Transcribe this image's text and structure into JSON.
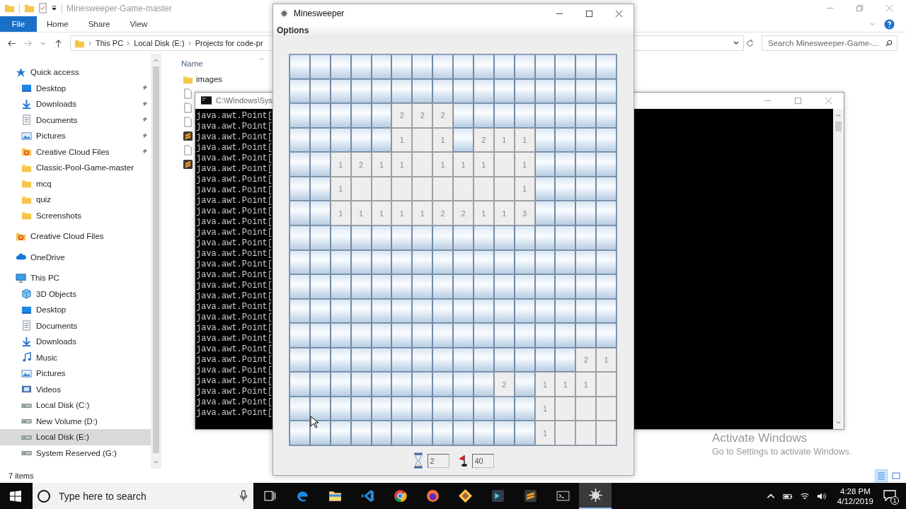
{
  "explorer": {
    "title": "Minesweeper-Game-master",
    "ribbon_tabs": [
      {
        "label": "File",
        "selected": true
      },
      {
        "label": "Home",
        "selected": false
      },
      {
        "label": "Share",
        "selected": false
      },
      {
        "label": "View",
        "selected": false
      }
    ],
    "breadcrumbs": [
      "This PC",
      "Local Disk (E:)",
      "Projects for code-pr"
    ],
    "search": {
      "placeholder": "Search Minesweeper-Game-..."
    },
    "navigation": [
      {
        "label": "Quick access",
        "kind": "star",
        "selected": false,
        "children": [
          {
            "label": "Desktop",
            "kind": "desktop",
            "pinned": true,
            "selected": false
          },
          {
            "label": "Downloads",
            "kind": "download",
            "pinned": true,
            "selected": false
          },
          {
            "label": "Documents",
            "kind": "documents",
            "pinned": true,
            "selected": false
          },
          {
            "label": "Pictures",
            "kind": "pictures",
            "pinned": true,
            "selected": false
          },
          {
            "label": "Creative Cloud Files",
            "kind": "cloudfiles",
            "pinned": true,
            "selected": false
          },
          {
            "label": "Classic-Pool-Game-master",
            "kind": "folder",
            "pinned": false,
            "selected": false
          },
          {
            "label": "mcq",
            "kind": "folder",
            "pinned": false,
            "selected": false
          },
          {
            "label": "quiz",
            "kind": "folder",
            "pinned": false,
            "selected": false
          },
          {
            "label": "Screenshots",
            "kind": "folder",
            "pinned": false,
            "selected": false
          }
        ]
      },
      {
        "label": "Creative Cloud Files",
        "kind": "cloudfiles",
        "selected": false
      },
      {
        "label": "OneDrive",
        "kind": "onedrive",
        "selected": false
      },
      {
        "label": "This PC",
        "kind": "pc",
        "selected": false,
        "children": [
          {
            "label": "3D Objects",
            "kind": "objects",
            "pinned": false,
            "selected": false
          },
          {
            "label": "Desktop",
            "kind": "desktop",
            "pinned": false,
            "selected": false
          },
          {
            "label": "Documents",
            "kind": "documents",
            "pinned": false,
            "selected": false
          },
          {
            "label": "Downloads",
            "kind": "download",
            "pinned": false,
            "selected": false
          },
          {
            "label": "Music",
            "kind": "music",
            "pinned": false,
            "selected": false
          },
          {
            "label": "Pictures",
            "kind": "pictures",
            "pinned": false,
            "selected": false
          },
          {
            "label": "Videos",
            "kind": "videos",
            "pinned": false,
            "selected": false
          },
          {
            "label": "Local Disk (C:)",
            "kind": "drive",
            "pinned": false,
            "selected": false
          },
          {
            "label": "New Volume (D:)",
            "kind": "drive",
            "pinned": false,
            "selected": false
          },
          {
            "label": "Local Disk (E:)",
            "kind": "drive",
            "pinned": false,
            "selected": true
          },
          {
            "label": "System Reserved (G:)",
            "kind": "drive",
            "pinned": false,
            "selected": false
          }
        ]
      }
    ],
    "column_header": "Name",
    "files": [
      {
        "name": "images",
        "kind": "folder"
      },
      {
        "kind": "file"
      },
      {
        "kind": "file"
      },
      {
        "kind": "file"
      },
      {
        "kind": "sublime"
      },
      {
        "kind": "file"
      },
      {
        "kind": "sublime"
      }
    ],
    "status": "7 items"
  },
  "console": {
    "title": "C:\\Windows\\Sys",
    "lines": [
      "java.awt.Point[",
      "java.awt.Point[",
      "java.awt.Point[",
      "java.awt.Point[",
      "java.awt.Point[",
      "java.awt.Point[",
      "java.awt.Point[",
      "java.awt.Point[",
      "java.awt.Point[",
      "java.awt.Point[",
      "java.awt.Point[",
      "java.awt.Point[",
      "java.awt.Point[",
      "java.awt.Point[",
      "java.awt.Point[",
      "java.awt.Point[",
      "java.awt.Point[",
      "java.awt.Point[",
      "java.awt.Point[",
      "java.awt.Point[",
      "java.awt.Point[",
      "java.awt.Point[",
      "java.awt.Point[",
      "java.awt.Point[",
      "java.awt.Point[",
      "java.awt.Point[",
      "java.awt.Point[",
      "java.awt.Point[",
      "java.awt.Point["
    ]
  },
  "minesweeper": {
    "title": "Minesweeper",
    "menu": [
      "Options"
    ],
    "rows": [
      {
        "cells": [
          {
            "open": false
          },
          {
            "open": false
          },
          {
            "open": false
          },
          {
            "open": false
          },
          {
            "open": false
          },
          {
            "open": false
          },
          {
            "open": false
          },
          {
            "open": false
          },
          {
            "open": false
          },
          {
            "open": false
          },
          {
            "open": false
          },
          {
            "open": false
          },
          {
            "open": false
          },
          {
            "open": false
          },
          {
            "open": false
          },
          {
            "open": false
          }
        ]
      },
      {
        "cells": [
          {
            "open": false
          },
          {
            "open": false
          },
          {
            "open": false
          },
          {
            "open": false
          },
          {
            "open": false
          },
          {
            "open": false
          },
          {
            "open": false
          },
          {
            "open": false
          },
          {
            "open": false
          },
          {
            "open": false
          },
          {
            "open": false
          },
          {
            "open": false
          },
          {
            "open": false
          },
          {
            "open": false
          },
          {
            "open": false
          },
          {
            "open": false
          }
        ]
      },
      {
        "cells": [
          {
            "open": false
          },
          {
            "open": false
          },
          {
            "open": false
          },
          {
            "open": false
          },
          {
            "open": false
          },
          {
            "open": true,
            "number": "2"
          },
          {
            "open": true,
            "number": "2"
          },
          {
            "open": true,
            "number": "2"
          },
          {
            "open": false
          },
          {
            "open": false
          },
          {
            "open": false
          },
          {
            "open": false
          },
          {
            "open": false
          },
          {
            "open": false
          },
          {
            "open": false
          },
          {
            "open": false
          }
        ]
      },
      {
        "cells": [
          {
            "open": false
          },
          {
            "open": false
          },
          {
            "open": false
          },
          {
            "open": false
          },
          {
            "open": false
          },
          {
            "open": true,
            "number": "1"
          },
          {
            "open": true
          },
          {
            "open": true,
            "number": "1"
          },
          {
            "open": false
          },
          {
            "open": true,
            "number": "2"
          },
          {
            "open": true,
            "number": "1"
          },
          {
            "open": true,
            "number": "1"
          },
          {
            "open": false
          },
          {
            "open": false
          },
          {
            "open": false
          },
          {
            "open": false
          }
        ]
      },
      {
        "cells": [
          {
            "open": false
          },
          {
            "open": false
          },
          {
            "open": true,
            "number": "1"
          },
          {
            "open": true,
            "number": "2"
          },
          {
            "open": true,
            "number": "1"
          },
          {
            "open": true,
            "number": "1"
          },
          {
            "open": true
          },
          {
            "open": true,
            "number": "1"
          },
          {
            "open": true,
            "number": "1"
          },
          {
            "open": true,
            "number": "1"
          },
          {
            "open": true
          },
          {
            "open": true,
            "number": "1"
          },
          {
            "open": false
          },
          {
            "open": false
          },
          {
            "open": false
          },
          {
            "open": false
          }
        ]
      },
      {
        "cells": [
          {
            "open": false
          },
          {
            "open": false
          },
          {
            "open": true,
            "number": "1"
          },
          {
            "open": true
          },
          {
            "open": true
          },
          {
            "open": true
          },
          {
            "open": true
          },
          {
            "open": true
          },
          {
            "open": true
          },
          {
            "open": true
          },
          {
            "open": true
          },
          {
            "open": true,
            "number": "1"
          },
          {
            "open": false
          },
          {
            "open": false
          },
          {
            "open": false
          },
          {
            "open": false
          }
        ]
      },
      {
        "cells": [
          {
            "open": false
          },
          {
            "open": false
          },
          {
            "open": true,
            "number": "1"
          },
          {
            "open": true,
            "number": "1"
          },
          {
            "open": true,
            "number": "1"
          },
          {
            "open": true,
            "number": "1"
          },
          {
            "open": true,
            "number": "1"
          },
          {
            "open": true,
            "number": "2"
          },
          {
            "open": true,
            "number": "2"
          },
          {
            "open": true,
            "number": "1"
          },
          {
            "open": true,
            "number": "1"
          },
          {
            "open": true,
            "number": "3"
          },
          {
            "open": false
          },
          {
            "open": false
          },
          {
            "open": false
          },
          {
            "open": false
          }
        ]
      },
      {
        "cells": [
          {
            "open": false
          },
          {
            "open": false
          },
          {
            "open": false
          },
          {
            "open": false
          },
          {
            "open": false
          },
          {
            "open": false
          },
          {
            "open": false
          },
          {
            "open": false
          },
          {
            "open": false
          },
          {
            "open": false
          },
          {
            "open": false
          },
          {
            "open": false
          },
          {
            "open": false
          },
          {
            "open": false
          },
          {
            "open": false
          },
          {
            "open": false
          }
        ]
      },
      {
        "cells": [
          {
            "open": false
          },
          {
            "open": false
          },
          {
            "open": false
          },
          {
            "open": false
          },
          {
            "open": false
          },
          {
            "open": false
          },
          {
            "open": false
          },
          {
            "open": false
          },
          {
            "open": false
          },
          {
            "open": false
          },
          {
            "open": false
          },
          {
            "open": false
          },
          {
            "open": false
          },
          {
            "open": false
          },
          {
            "open": false
          },
          {
            "open": false
          }
        ]
      },
      {
        "cells": [
          {
            "open": false
          },
          {
            "open": false
          },
          {
            "open": false
          },
          {
            "open": false
          },
          {
            "open": false
          },
          {
            "open": false
          },
          {
            "open": false
          },
          {
            "open": false
          },
          {
            "open": false
          },
          {
            "open": false
          },
          {
            "open": false
          },
          {
            "open": false
          },
          {
            "open": false
          },
          {
            "open": false
          },
          {
            "open": false
          },
          {
            "open": false
          }
        ]
      },
      {
        "cells": [
          {
            "open": false
          },
          {
            "open": false
          },
          {
            "open": false
          },
          {
            "open": false
          },
          {
            "open": false
          },
          {
            "open": false
          },
          {
            "open": false
          },
          {
            "open": false
          },
          {
            "open": false
          },
          {
            "open": false
          },
          {
            "open": false
          },
          {
            "open": false
          },
          {
            "open": false
          },
          {
            "open": false
          },
          {
            "open": false
          },
          {
            "open": false
          }
        ]
      },
      {
        "cells": [
          {
            "open": false
          },
          {
            "open": false
          },
          {
            "open": false
          },
          {
            "open": false
          },
          {
            "open": false
          },
          {
            "open": false
          },
          {
            "open": false
          },
          {
            "open": false
          },
          {
            "open": false
          },
          {
            "open": false
          },
          {
            "open": false
          },
          {
            "open": false
          },
          {
            "open": false
          },
          {
            "open": false
          },
          {
            "open": false
          },
          {
            "open": false
          }
        ]
      },
      {
        "cells": [
          {
            "open": false
          },
          {
            "open": false
          },
          {
            "open": false
          },
          {
            "open": false
          },
          {
            "open": false
          },
          {
            "open": false
          },
          {
            "open": false
          },
          {
            "open": false
          },
          {
            "open": false
          },
          {
            "open": false
          },
          {
            "open": false
          },
          {
            "open": false
          },
          {
            "open": false
          },
          {
            "open": false
          },
          {
            "open": true,
            "number": "2"
          },
          {
            "open": true,
            "number": "1"
          }
        ]
      },
      {
        "cells": [
          {
            "open": false
          },
          {
            "open": false
          },
          {
            "open": false
          },
          {
            "open": false
          },
          {
            "open": false
          },
          {
            "open": false
          },
          {
            "open": false
          },
          {
            "open": false
          },
          {
            "open": false
          },
          {
            "open": false
          },
          {
            "open": true,
            "number": "2"
          },
          {
            "open": false
          },
          {
            "open": true,
            "number": "1"
          },
          {
            "open": true,
            "number": "1"
          },
          {
            "open": true,
            "number": "1"
          },
          {
            "open": true
          }
        ]
      },
      {
        "cells": [
          {
            "open": false
          },
          {
            "open": false
          },
          {
            "open": false
          },
          {
            "open": false
          },
          {
            "open": false
          },
          {
            "open": false
          },
          {
            "open": false
          },
          {
            "open": false
          },
          {
            "open": false
          },
          {
            "open": false
          },
          {
            "open": false
          },
          {
            "open": false
          },
          {
            "open": true,
            "number": "1"
          },
          {
            "open": true
          },
          {
            "open": true
          },
          {
            "open": true
          }
        ]
      },
      {
        "cells": [
          {
            "open": false
          },
          {
            "open": false
          },
          {
            "open": false
          },
          {
            "open": false
          },
          {
            "open": false
          },
          {
            "open": false
          },
          {
            "open": false
          },
          {
            "open": false
          },
          {
            "open": false
          },
          {
            "open": false
          },
          {
            "open": false
          },
          {
            "open": false
          },
          {
            "open": true,
            "number": "1"
          },
          {
            "open": true
          },
          {
            "open": true
          },
          {
            "open": true
          }
        ]
      }
    ],
    "timer": "2",
    "mines": "40"
  },
  "activation": {
    "title": "Activate Windows",
    "subtitle": "Go to Settings to activate Windows."
  },
  "taskbar": {
    "search_placeholder": "Type here to search",
    "apps": [
      {
        "kind": "taskview",
        "active": false
      },
      {
        "kind": "edge",
        "active": false
      },
      {
        "kind": "explorer",
        "active": false
      },
      {
        "kind": "vscode",
        "active": false
      },
      {
        "kind": "chrome",
        "active": false
      },
      {
        "kind": "firefox",
        "active": false
      },
      {
        "kind": "git",
        "active": false
      },
      {
        "kind": "terminal",
        "active": false
      },
      {
        "kind": "sublime",
        "active": false
      },
      {
        "kind": "cmd",
        "active": false
      },
      {
        "kind": "java",
        "active": true
      }
    ],
    "time": "4:28 PM",
    "date": "4/12/2019",
    "notifications": "1"
  }
}
